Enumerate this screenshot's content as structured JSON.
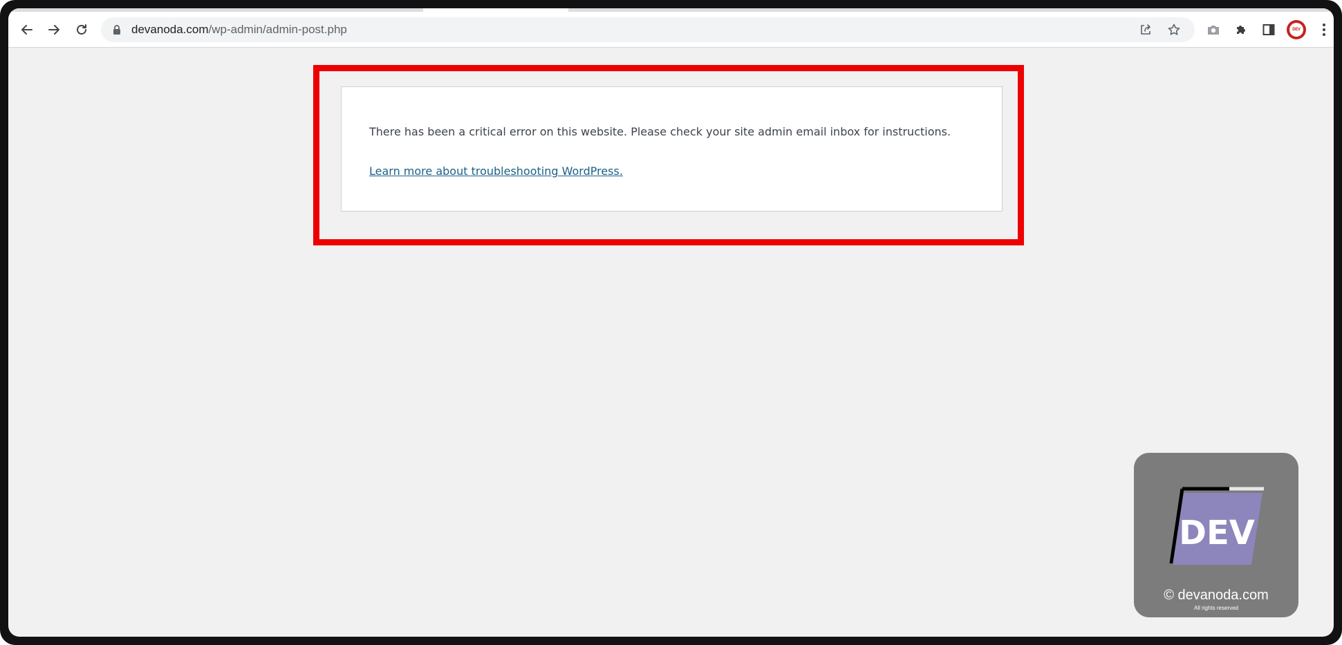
{
  "browser": {
    "url_domain": "devanoda.com",
    "url_path": "/wp-admin/admin-post.php",
    "icons": [
      "back-arrow-icon",
      "forward-arrow-icon",
      "reload-icon",
      "lock-icon",
      "share-icon",
      "star-icon",
      "camera-icon",
      "extensions-icon",
      "side-panel-icon",
      "profile-avatar",
      "more-menu-icon"
    ]
  },
  "page": {
    "error_message": "There has been a critical error on this website. Please check your site admin email inbox for instructions.",
    "help_link": "Learn more about troubleshooting WordPress."
  },
  "highlight": {
    "color": "#ee0000"
  },
  "watermark": {
    "logo_text": "DEV",
    "copyright": "© devanoda.com",
    "rights": "All rights reserved"
  },
  "colors": {
    "page_background": "#f1f1f1",
    "link": "#1c5f86",
    "text": "#3c434a",
    "logo_purple": "#8c86bc"
  }
}
